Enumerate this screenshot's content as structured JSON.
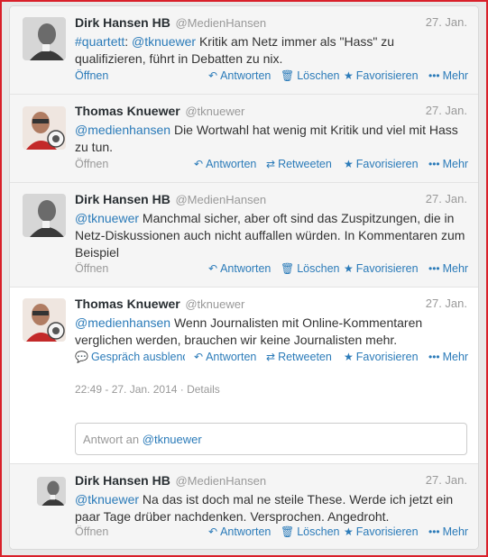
{
  "conversation": [
    {
      "name": "Dirk Hansen HB",
      "handle": "@MedienHansen",
      "time": "27. Jan.",
      "avatar": "dirk-hansen-avatar",
      "parts": [
        {
          "t": "#quartett",
          "link": true
        },
        {
          "t": ": ",
          "link": false
        },
        {
          "t": "@tknuewer",
          "link": true
        },
        {
          "t": " Kritik am Netz immer als \"Hass\" zu qualifizieren, führt in Debatten zu nix.",
          "link": false
        }
      ],
      "actions": {
        "open": "Öffnen",
        "reply": "Antworten",
        "second": "Löschen",
        "fav": "Favorisieren",
        "more": "Mehr"
      }
    },
    {
      "name": "Thomas Knuewer",
      "handle": "@tknuewer",
      "time": "27. Jan.",
      "avatar": "thomas-knuewer-avatar",
      "parts": [
        {
          "t": "@medienhansen",
          "link": true
        },
        {
          "t": " Die Wortwahl hat wenig mit Kritik und viel mit Hass zu tun.",
          "link": false
        }
      ],
      "actions": {
        "open": "Öffnen",
        "reply": "Antworten",
        "second": "Retweeten",
        "fav": "Favorisieren",
        "more": "Mehr"
      }
    },
    {
      "name": "Dirk Hansen HB",
      "handle": "@MedienHansen",
      "time": "27. Jan.",
      "avatar": "dirk-hansen-avatar",
      "parts": [
        {
          "t": "@tknuewer",
          "link": true
        },
        {
          "t": " Manchmal sicher, aber oft sind das Zuspitzungen, die in Netz-Diskussionen auch nicht auffallen würden. In Kommentaren zum Beispiel",
          "link": false
        }
      ],
      "actions": {
        "open": "Öffnen",
        "reply": "Antworten",
        "second": "Löschen",
        "fav": "Favorisieren",
        "more": "Mehr"
      }
    },
    {
      "name": "Thomas Knuewer",
      "handle": "@tknuewer",
      "time": "27. Jan.",
      "avatar": "thomas-knuewer-avatar",
      "parts": [
        {
          "t": "@medienhansen",
          "link": true
        },
        {
          "t": " Wenn Journalisten mit Online-Kommentaren verglichen werden, brauchen wir keine Journalisten mehr.",
          "link": false
        }
      ],
      "actions": {
        "open": "Gespräch ausblend",
        "reply": "Antworten",
        "second": "Retweeten",
        "fav": "Favorisieren",
        "more": "Mehr"
      },
      "details_time": "22:49 - 27. Jan. 2014",
      "details_sep": " · ",
      "details_label": "Details",
      "reply_prefix": "Antwort an ",
      "reply_handle": "@tknuewer"
    },
    {
      "name": "Dirk Hansen HB",
      "handle": "@MedienHansen",
      "time": "27. Jan.",
      "avatar": "dirk-hansen-avatar",
      "parts": [
        {
          "t": "@tknuewer",
          "link": true
        },
        {
          "t": " Na das ist doch mal ne steile These. Werde ich jetzt ein paar Tage drüber nachdenken. Versprochen. Angedroht.",
          "link": false
        }
      ],
      "actions": {
        "open": "Öffnen",
        "reply": "Antworten",
        "second": "Löschen",
        "fav": "Favorisieren",
        "more": "Mehr"
      }
    }
  ],
  "icons": {
    "reply": "reply-icon",
    "delete": "trash-icon",
    "retweet": "retweet-icon",
    "favorite": "star-icon",
    "more": "more-dots-icon",
    "conversation": "speech-bubble-icon"
  },
  "colors": {
    "link": "#2b7bb9",
    "muted": "#999999",
    "name": "#292f33",
    "highlight_bg": "#f5f5f5",
    "frame": "#d9202a"
  }
}
